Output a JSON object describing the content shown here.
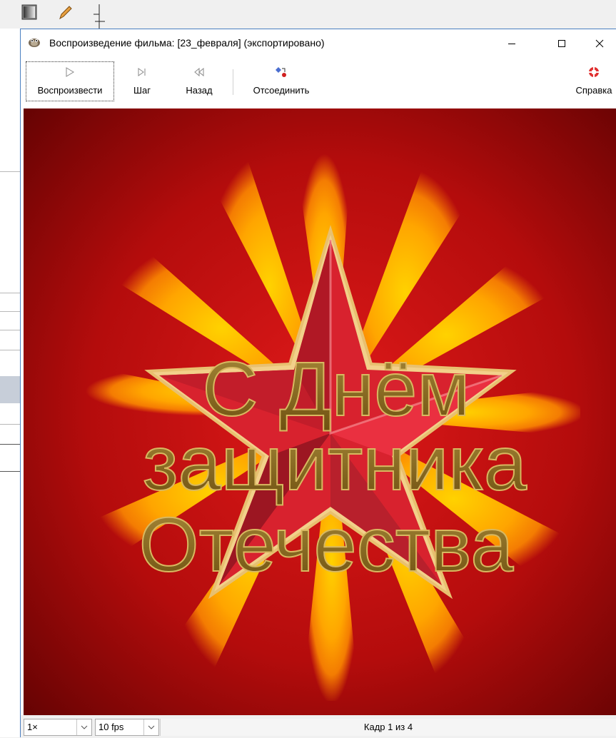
{
  "window": {
    "title": "Воспроизведение фильма: [23_февраля] (экспортировано)"
  },
  "toolbar": {
    "play_label": "Воспроизвести",
    "step_label": "Шаг",
    "back_label": "Назад",
    "detach_label": "Отсоединить",
    "help_label": "Справка"
  },
  "image": {
    "line1": "С Днём",
    "line2": "защитника",
    "line3": "Отечества",
    "colors": {
      "background": "#b00d0d",
      "rays": "#ffa500",
      "star": "#d8222e",
      "text": "#8a6a1a"
    }
  },
  "status": {
    "zoom": "1×",
    "fps": "10 fps",
    "frame": "Кадр 1 из 4"
  }
}
